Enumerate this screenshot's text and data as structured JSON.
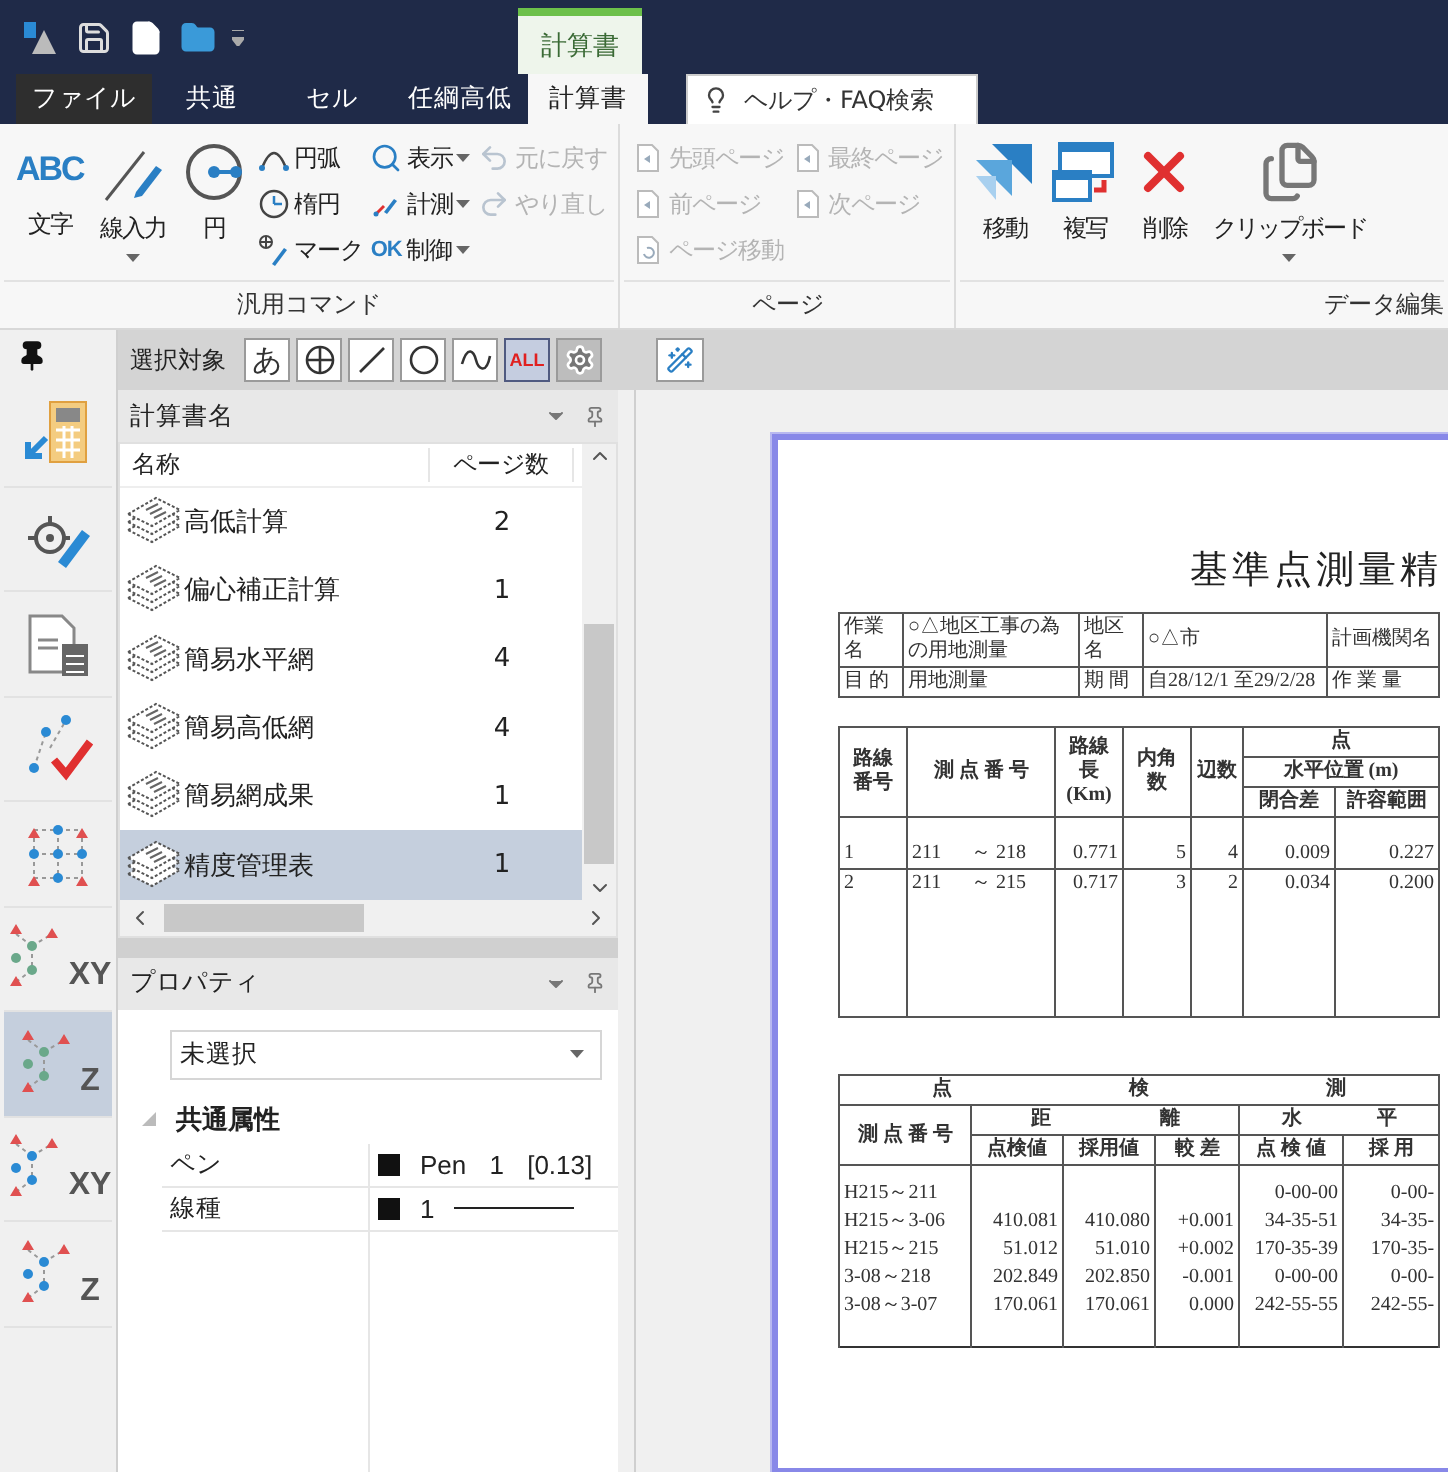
{
  "title_bar": {
    "context_tab": "計算書"
  },
  "tabs": [
    {
      "label": "ファイル",
      "kind": "file",
      "selected": false
    },
    {
      "label": "共通",
      "kind": "tab",
      "selected": false
    },
    {
      "label": "セル",
      "kind": "tab",
      "selected": false
    },
    {
      "label": "任綱高低",
      "kind": "tab",
      "selected": false
    },
    {
      "label": "計算書",
      "kind": "tab",
      "selected": true
    }
  ],
  "search": {
    "placeholder": "ヘルプ・FAQ検索"
  },
  "ribbon": {
    "groups": [
      {
        "label": "汎用コマンド",
        "large": [
          {
            "label": "文字",
            "icon_text": "ABC",
            "dropdown": false
          },
          {
            "label": "線入力",
            "dropdown": true
          },
          {
            "label": "円",
            "dropdown": false
          }
        ],
        "columns": [
          [
            {
              "label": "円弧",
              "dropdown": false,
              "disabled": false
            },
            {
              "label": "楕円",
              "dropdown": false,
              "disabled": false
            },
            {
              "label": "マーク",
              "dropdown": false,
              "disabled": false
            }
          ],
          [
            {
              "label": "表示",
              "dropdown": true,
              "disabled": false
            },
            {
              "label": "計測",
              "dropdown": true,
              "disabled": false
            },
            {
              "label": "制御",
              "icon_text": "OK",
              "dropdown": true,
              "disabled": false
            }
          ],
          [
            {
              "label": "元に戻す",
              "dropdown": false,
              "disabled": true
            },
            {
              "label": "やり直し",
              "dropdown": false,
              "disabled": true
            }
          ]
        ]
      },
      {
        "label": "ページ",
        "columns": [
          [
            {
              "label": "先頭ページ",
              "dropdown": false,
              "disabled": true
            },
            {
              "label": "前ページ",
              "dropdown": false,
              "disabled": true
            },
            {
              "label": "ページ移動",
              "dropdown": false,
              "disabled": true
            }
          ],
          [
            {
              "label": "最終ページ",
              "dropdown": false,
              "disabled": true
            },
            {
              "label": "次ページ",
              "dropdown": false,
              "disabled": true
            }
          ]
        ]
      },
      {
        "label": "データ編集",
        "large": [
          {
            "label": "移動",
            "dropdown": false
          },
          {
            "label": "複写",
            "dropdown": false
          },
          {
            "label": "削除",
            "dropdown": false
          },
          {
            "label": "クリップボード",
            "dropdown": true
          }
        ]
      }
    ]
  },
  "sidebar": {
    "tools": [
      {
        "kind": "calc-import",
        "selected": false
      },
      {
        "kind": "survey-pen",
        "selected": false
      },
      {
        "kind": "doc-calc",
        "selected": false
      },
      {
        "kind": "check",
        "selected": false
      },
      {
        "kind": "grid",
        "selected": false
      },
      {
        "kind": "net-points",
        "label": "XY",
        "selected": false
      },
      {
        "kind": "net-points",
        "label": "Z",
        "selected": true
      },
      {
        "kind": "route-points",
        "label": "XY",
        "selected": false
      },
      {
        "kind": "route-points",
        "label": "Z",
        "selected": false
      }
    ]
  },
  "selection_bar": {
    "label": "選択対象",
    "filters": [
      {
        "kind": "text",
        "label": "あ",
        "selected": false
      },
      {
        "kind": "point",
        "selected": false
      },
      {
        "kind": "line",
        "selected": false
      },
      {
        "kind": "circle",
        "selected": false
      },
      {
        "kind": "curve",
        "selected": false
      },
      {
        "kind": "text",
        "label": "ALL",
        "selected": true
      },
      {
        "kind": "gear",
        "selected": false
      }
    ]
  },
  "calc_list": {
    "title": "計算書名",
    "columns": [
      "名称",
      "ページ数"
    ],
    "rows": [
      {
        "name": "高低計算",
        "pages": "2",
        "selected": false
      },
      {
        "name": "偏心補正計算",
        "pages": "1",
        "selected": false
      },
      {
        "name": "簡易水平網",
        "pages": "4",
        "selected": false
      },
      {
        "name": "簡易高低網",
        "pages": "4",
        "selected": false
      },
      {
        "name": "簡易網成果",
        "pages": "1",
        "selected": false
      },
      {
        "name": "精度管理表",
        "pages": "1",
        "selected": true
      }
    ]
  },
  "properties": {
    "title": "プロパティ",
    "selector": "未選択",
    "category": {
      "label": "共通属性",
      "expanded": true
    },
    "rows": [
      {
        "name": "ペン",
        "kind": "pen",
        "value": "Pen 1 [0.13]"
      },
      {
        "name": "線種",
        "kind": "linetype",
        "value": "1"
      }
    ]
  },
  "document": {
    "title": "基準点測量精",
    "info": [
      [
        "作業名",
        "○△地区工事の為の用地測量",
        "地区名",
        "○△市",
        "計画機関名"
      ],
      [
        "目 的",
        "用地測量",
        "期 間",
        "自28/12/1 至29/2/28",
        "作 業 量"
      ]
    ],
    "route_table": {
      "route": "路線番号",
      "points": "測 点 番 号",
      "length": "路線長",
      "length_unit": "(Km)",
      "angles": "内角数",
      "sides": "辺数",
      "group": "点",
      "sub_group": "水平位置 (m)",
      "closure": "閉合差",
      "tolerance": "許容範囲",
      "rows": [
        [
          "1",
          "211",
          "～ 218",
          "0.771",
          "5",
          "4",
          "0.009",
          "0.227"
        ],
        [
          "2",
          "211",
          "～ 215",
          "0.717",
          "3",
          "2",
          "0.034",
          "0.200"
        ]
      ]
    },
    "check_table": {
      "title_parts": [
        "点",
        "検",
        "測"
      ],
      "point_header": "測 点 番 号",
      "groups": [
        {
          "parts": [
            "距",
            "離"
          ],
          "columns": [
            "点検値",
            "採用値",
            "較 差"
          ]
        },
        {
          "parts": [
            "水",
            "平"
          ],
          "columns": [
            "点 検 値",
            "採 用"
          ]
        }
      ],
      "rows": [
        [
          "H215～211",
          null,
          null,
          null,
          "0-00-00",
          "0-00-"
        ],
        [
          "H215～3-06",
          "410.081",
          "410.080",
          "+0.001",
          "34-35-51",
          "34-35-"
        ],
        [
          "H215～215",
          "51.012",
          "51.010",
          "+0.002",
          "170-35-39",
          "170-35-"
        ],
        [
          "3-08～218",
          "202.849",
          "202.850",
          "-0.001",
          "0-00-00",
          "0-00-"
        ],
        [
          "3-08～3-07",
          "170.061",
          "170.061",
          "0.000",
          "242-55-55",
          "242-55-"
        ]
      ]
    }
  }
}
